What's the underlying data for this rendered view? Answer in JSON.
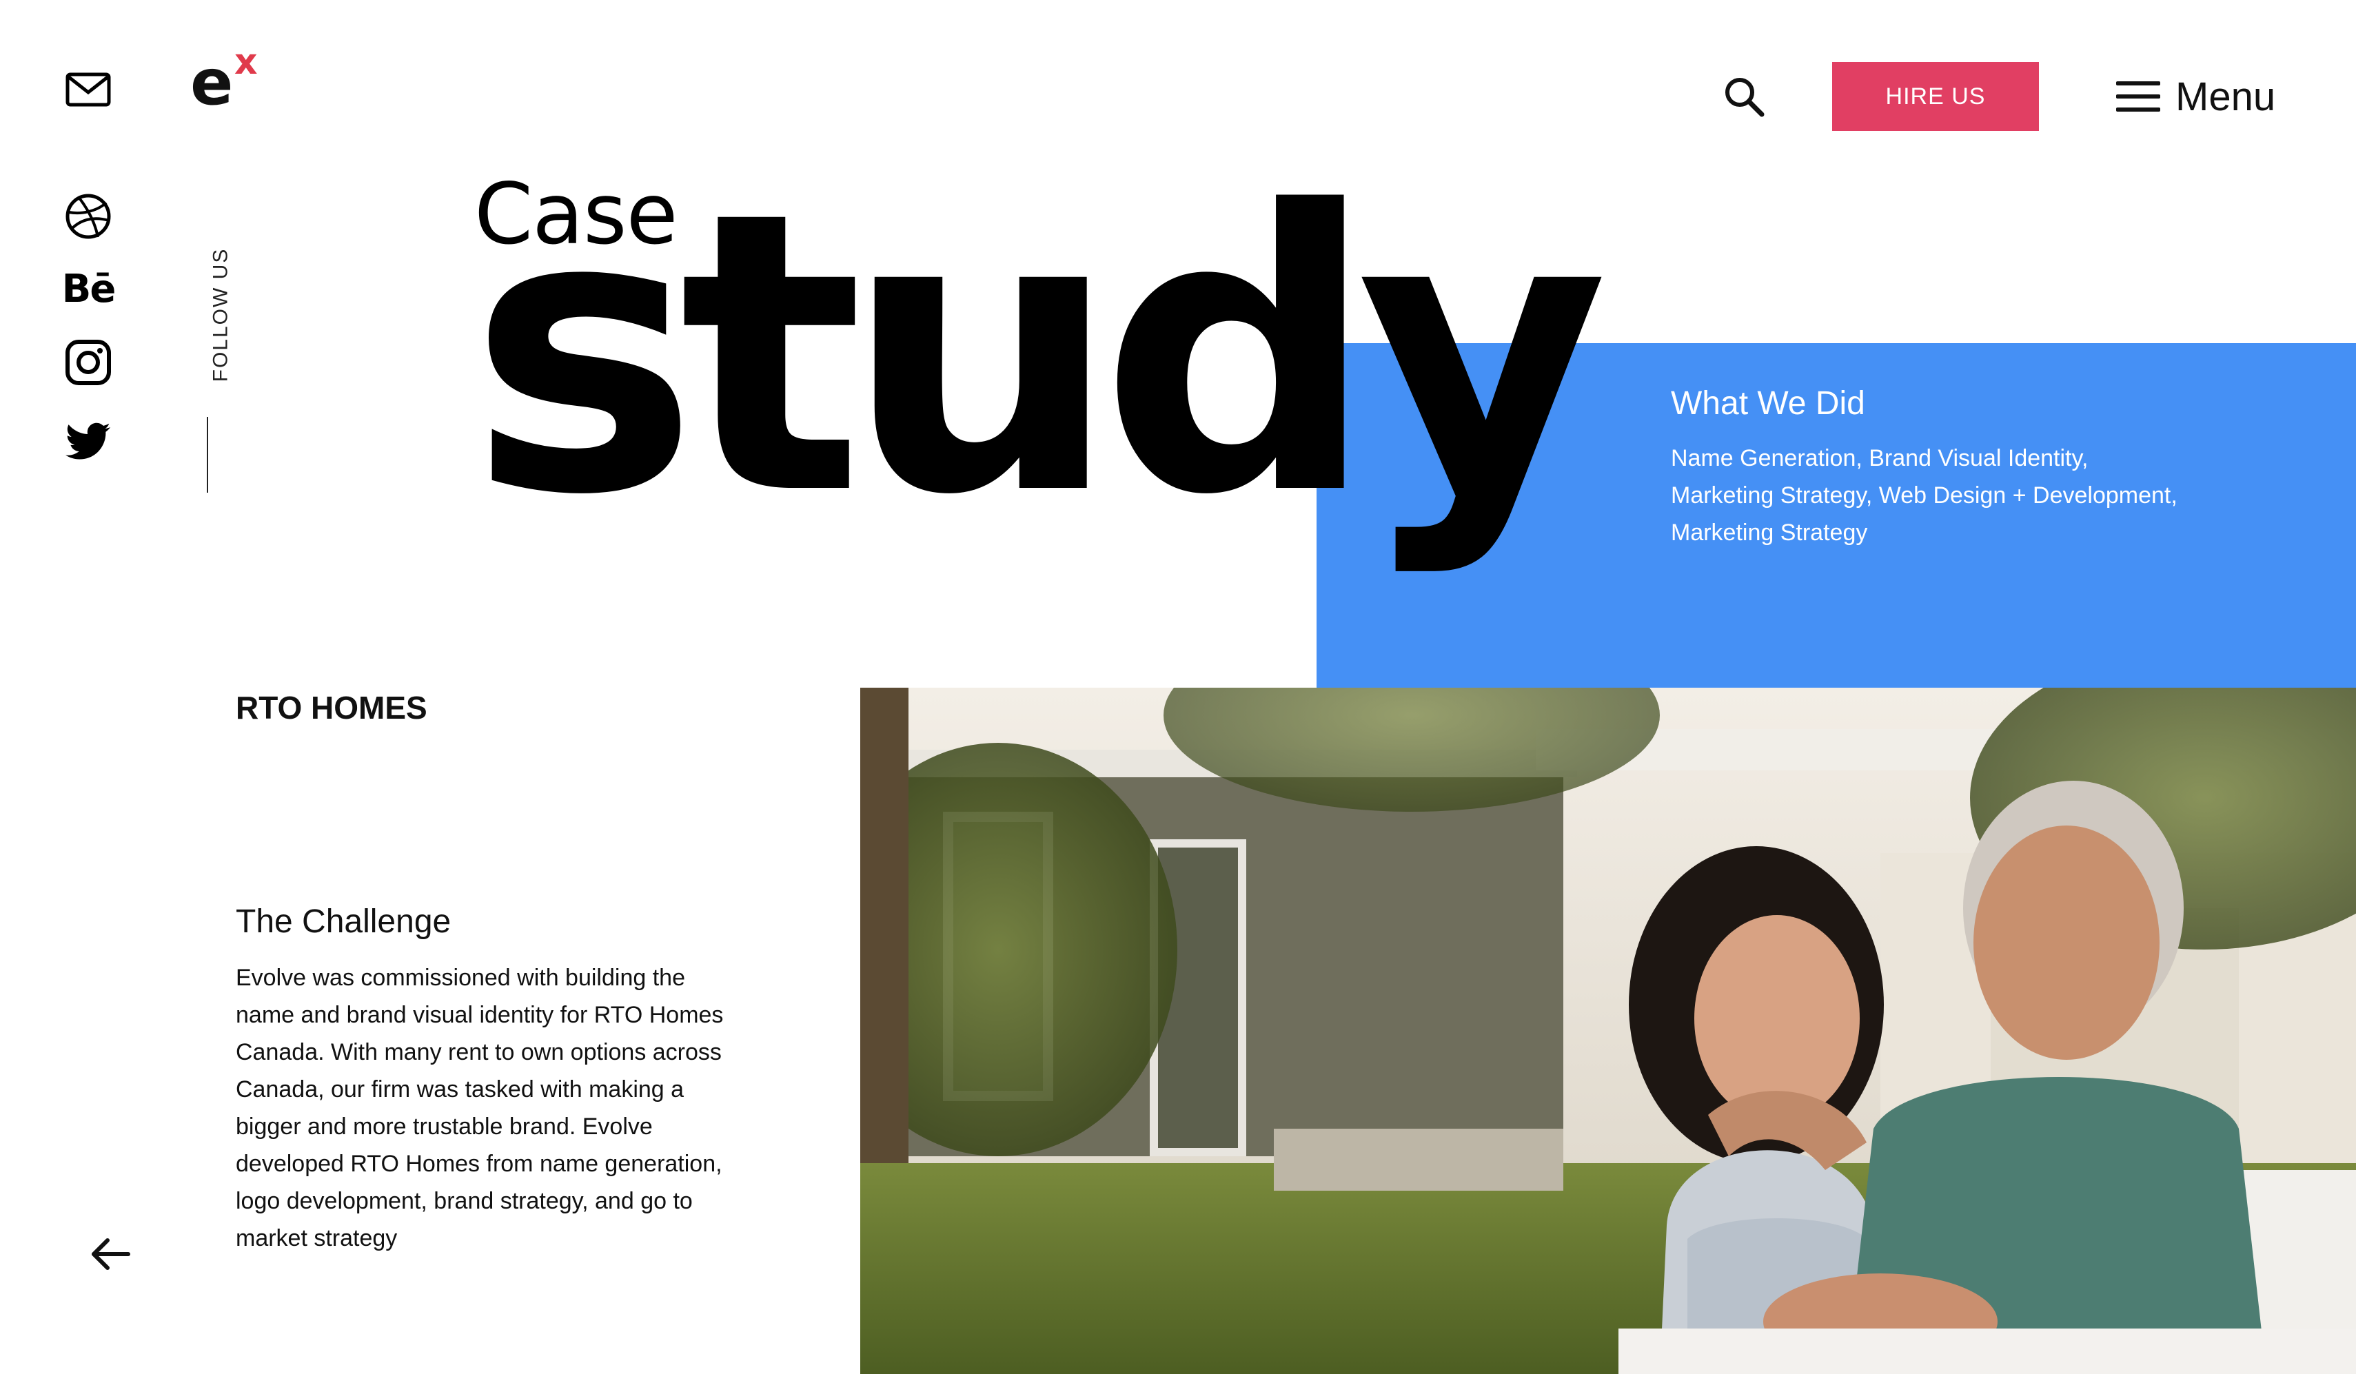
{
  "brand": {
    "logo_letter": "e",
    "logo_mark": "x",
    "logo_color": "#e03a4b"
  },
  "sidebar": {
    "follow_label": "FOLLOW US",
    "behance_text": "Bē",
    "icons": [
      "mail-icon",
      "dribbble-icon",
      "behance-icon",
      "instagram-icon",
      "twitter-icon"
    ]
  },
  "header": {
    "hire_label": "HIRE US",
    "menu_label": "Menu",
    "hire_color": "#e13f63"
  },
  "hero": {
    "line1": "Case",
    "line2": "study",
    "panel_color": "#4590f5"
  },
  "what_we_did": {
    "title": "What We Did",
    "services": "Name Generation, Brand Visual Identity,\nMarketing Strategy, Web Design + Development,\nMarketing Strategy"
  },
  "project": {
    "name": "RTO HOMES",
    "challenge_title": "The Challenge",
    "challenge_body": "Evolve was commissioned with building the name and brand visual identity for RTO Homes Canada. With many rent to own options across Canada, our firm was tasked with making a bigger and more trustable brand. Evolve developed RTO Homes from name generation, logo development, brand strategy, and go to market strategy"
  }
}
